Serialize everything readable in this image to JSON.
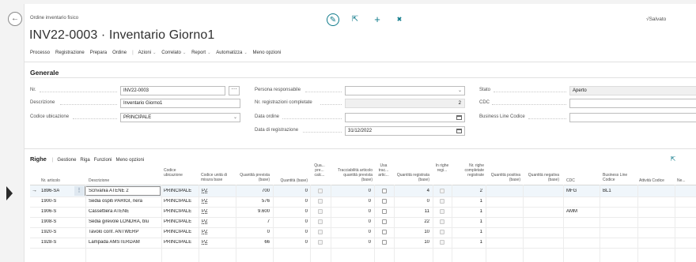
{
  "header": {
    "caption": "Ordine inventario fisico",
    "title": "INV22-0003 · Inventario Giorno1",
    "saved": "√Salvato",
    "back_glyph": "←",
    "edit_glyph": "✎",
    "share_glyph": "⇱",
    "add_glyph": "+",
    "delete_glyph": "✖"
  },
  "actions": {
    "processo": "Processo",
    "registrazione": "Registrazione",
    "prepara": "Prepara",
    "ordine": "Ordine",
    "azioni": "Azioni",
    "correlato": "Correlato",
    "report": "Report",
    "automatizza": "Automatizza",
    "meno_opzioni": "Meno opzioni"
  },
  "general": {
    "title": "Generale",
    "nr_label": "Nr.",
    "nr_value": "INV22-0003",
    "descrizione_label": "Descrizione",
    "descrizione_value": "Inventario Giorno1",
    "codice_ubicazione_label": "Codice ubicazione",
    "codice_ubicazione_value": "PRINCIPALE",
    "persona_label": "Persona responsabile",
    "persona_value": "",
    "nr_reg_label": "Nr. registrazioni completate",
    "nr_reg_value": "2",
    "data_ordine_label": "Data ordine",
    "data_ordine_value": "",
    "data_reg_label": "Data di registrazione",
    "data_reg_value": "31/12/2022",
    "stato_label": "Stato",
    "stato_value": "Aperto",
    "cdc_label": "CDC",
    "cdc_value": "",
    "blc_label": "Business Line Codice",
    "blc_value": "",
    "ellipsis": "⋯",
    "chevron": "⌵"
  },
  "lines": {
    "title": "Righe",
    "gestione": "Gestione",
    "riga": "Riga",
    "funzioni": "Funzioni",
    "meno_opzioni": "Meno opzioni",
    "columns": {
      "nr_articolo": "Nr. articolo",
      "descrizione": "Descrizione",
      "codice_ubicazione": "Codice ubicazione",
      "codice_unita": "Codice unità di misura base",
      "qta_prevista": "Quantità prevista (base)",
      "qta_base": "Quantità (base)",
      "qta_prev_calc": "Qua... pre... calc...",
      "tracc": "Tracciabilità articolo quantità prevista (base)",
      "usa_tracc": "Usa trac... artic...",
      "qta_registrata": "Quantità registrata (base)",
      "in_righe_reg": "In righe regi...",
      "nr_righe_compl": "Nr. righe completate registrate",
      "qta_positiva": "Quantità positiva (base)",
      "qta_negativa": "Quantità negativa (base)",
      "cdc": "CDC",
      "blc": "Business Line Codice",
      "attivita": "Attività Codice",
      "last": "Ne..."
    },
    "rows": [
      {
        "item": "1896-SA",
        "desc": "Scrivania ATENE 2",
        "loc": "PRINCIPALE",
        "uom": "PZ",
        "expected": "700",
        "qty": "0",
        "tracking": "0",
        "registered": "4",
        "completed": "2",
        "cdc": "MFG",
        "blc": "BL1"
      },
      {
        "item": "1900-S",
        "desc": "Sedia ospiti PARIGI, nera",
        "loc": "PRINCIPALE",
        "uom": "PZ",
        "expected": "576",
        "qty": "0",
        "tracking": "0",
        "registered": "0",
        "completed": "1",
        "cdc": "",
        "blc": ""
      },
      {
        "item": "1906-S",
        "desc": "Cassettiera ATENE",
        "loc": "PRINCIPALE",
        "uom": "PZ",
        "expected": "9.600",
        "qty": "0",
        "tracking": "0",
        "registered": "11",
        "completed": "1",
        "cdc": "AMM",
        "blc": ""
      },
      {
        "item": "1908-S",
        "desc": "Sedia girevole LONDRA, blu",
        "loc": "PRINCIPALE",
        "uom": "PZ",
        "expected": "7",
        "qty": "0",
        "tracking": "0",
        "registered": "22",
        "completed": "1",
        "cdc": "",
        "blc": ""
      },
      {
        "item": "1920-S",
        "desc": "Tavolo conf. ANTWERP",
        "loc": "PRINCIPALE",
        "uom": "PZ",
        "expected": "0",
        "qty": "0",
        "tracking": "0",
        "registered": "10",
        "completed": "1",
        "cdc": "",
        "blc": ""
      },
      {
        "item": "1928-S",
        "desc": "Lampada AMSTERDAM",
        "loc": "PRINCIPALE",
        "uom": "PZ",
        "expected": "66",
        "qty": "0",
        "tracking": "0",
        "registered": "10",
        "completed": "1",
        "cdc": "",
        "blc": ""
      }
    ]
  },
  "colors": {
    "accent": "#0e7a8a",
    "selected_row": "#f0f6fb"
  }
}
